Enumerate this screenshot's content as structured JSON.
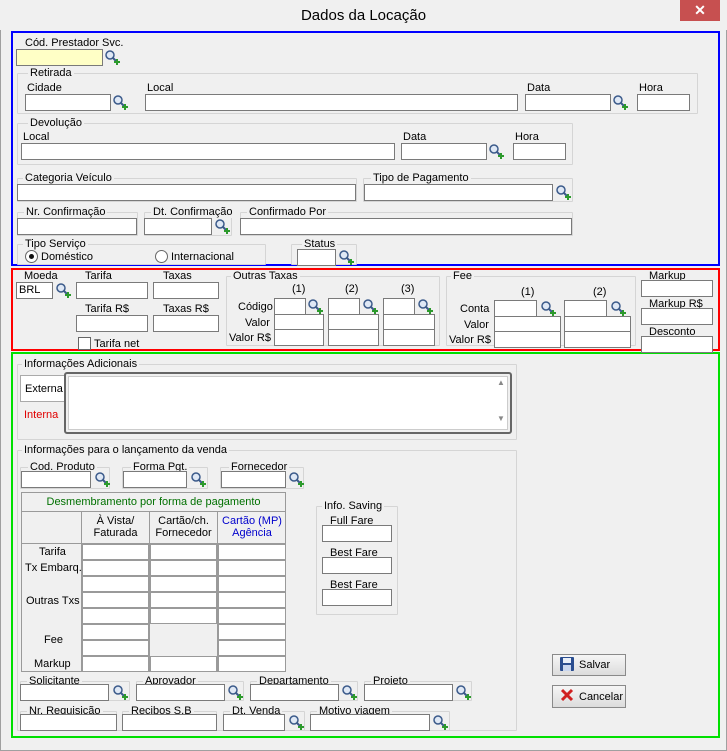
{
  "window": {
    "title": "Dados da Locação",
    "close_label": "✕"
  },
  "section1": {
    "cod_prestador_label": "Cód. Prestador Svc.",
    "retirada": {
      "title": "Retirada",
      "cidade": "Cidade",
      "local": "Local",
      "data": "Data",
      "hora": "Hora"
    },
    "devolucao": {
      "title": "Devolução",
      "local": "Local",
      "data": "Data",
      "hora": "Hora"
    },
    "categoria_veiculo": "Categoria Veículo",
    "tipo_pagamento": "Tipo de Pagamento",
    "nr_confirmacao": "Nr. Confirmação",
    "dt_confirmacao": "Dt. Confirmação",
    "confirmado_por": "Confirmado Por",
    "tipo_servico": {
      "title": "Tipo Serviço",
      "domestico": "Doméstico",
      "internacional": "Internacional",
      "selected": "Doméstico"
    },
    "status": "Status"
  },
  "section2": {
    "moeda": "Moeda",
    "moeda_value": "BRL",
    "tarifa": "Tarifa",
    "taxas": "Taxas",
    "tarifa_rs": "Tarifa R$",
    "taxas_rs": "Taxas R$",
    "tarifa_net": "Tarifa net",
    "outras_taxas": {
      "title": "Outras Taxas",
      "col1": "(1)",
      "col2": "(2)",
      "col3": "(3)",
      "codigo": "Código",
      "valor": "Valor",
      "valor_rs": "Valor R$"
    },
    "fee": {
      "title": "Fee",
      "col1": "(1)",
      "col2": "(2)",
      "conta": "Conta",
      "valor": "Valor",
      "valor_rs": "Valor R$"
    },
    "markup": "Markup",
    "markup_rs": "Markup R$",
    "desconto": "Desconto"
  },
  "section3": {
    "info_adicionais": "Informações Adicionais",
    "tabs": [
      "Externa",
      "Interna"
    ],
    "info_lancamento": "Informações para o lançamento da venda",
    "cod_produto": "Cod. Produto",
    "forma_pgt": "Forma Pgt.",
    "fornecedor": "Fornecedor",
    "desmembramento": "Desmembramento por forma de pagamento",
    "col_headers": [
      "À Vista/\nFaturada",
      "Cartão/ch.\nFornecedor",
      "Cartão (MP)\nAgência"
    ],
    "row_labels": [
      "Tarifa",
      "Tx Embarq.",
      "Outras Txs",
      "Fee",
      "Markup"
    ],
    "info_saving": {
      "title": "Info. Saving",
      "full_fare": "Full Fare",
      "best_fare_1": "Best Fare",
      "best_fare_2": "Best Fare"
    },
    "solicitante": "Solicitante",
    "aprovador": "Aprovador",
    "departamento": "Departamento",
    "projeto": "Projeto",
    "nr_requisicao": "Nr. Requisição",
    "recibos_sb": "Recibos S.B",
    "dt_venda": "Dt. Venda",
    "motivo_viagem": "Motivo viagem",
    "salvar": "Salvar",
    "cancelar": "Cancelar"
  },
  "colors": {
    "blue_frame": "#0000ff",
    "red_frame": "#ff0000",
    "green_frame": "#00e000",
    "grid_title": "#007000",
    "mp_agencia": "#0000cc",
    "interna_tab": "#e00000"
  }
}
